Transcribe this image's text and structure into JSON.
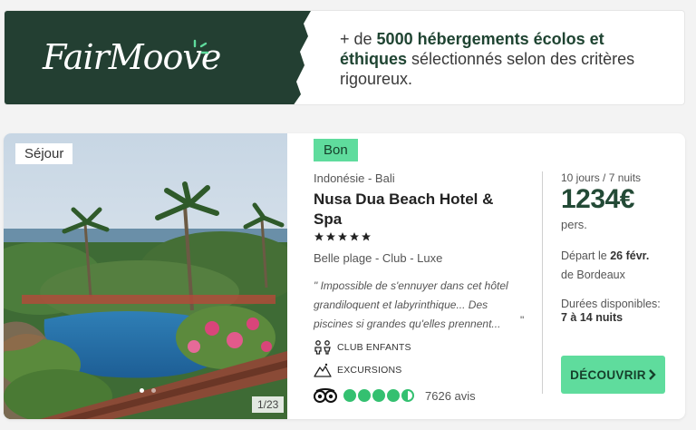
{
  "banner": {
    "logo_text": "FairMoove",
    "text_prefix": "+ de ",
    "text_bold": "5000 hébergements écolos et éthiques",
    "text_suffix": " sélectionnés selon des critères rigoureux."
  },
  "card": {
    "tag": "Séjour",
    "photo_counter": "1/23",
    "rating_label": "Bon",
    "location": "Indonésie - Bali",
    "name": "Nusa Dua Beach Hotel & Spa",
    "stars": 5,
    "features": "Belle plage - Club - Luxe",
    "quote": "\" Impossible de s'ennuyer dans cet hôtel grandiloquent et labyrinthique... Des piscines si grandes qu'elles prennent...",
    "quote_close": "\"",
    "amenities": [
      "CLUB ENFANTS",
      "EXCURSIONS"
    ],
    "review_count": "7626 avis",
    "duration": "10 jours / 7 nuits",
    "price": "1234€",
    "per": "pers.",
    "depart_prefix": "Départ le ",
    "depart_date": "26 févr.",
    "depart_city": "de Bordeaux",
    "durees_label": "Durées disponibles:",
    "durees_value": "7 à 14 nuits",
    "cta_label": "DÉCOUVRIR"
  },
  "colors": {
    "brand_dark": "#233f32",
    "accent_green": "#5fdc9d",
    "price_green": "#234a36",
    "tripadvisor_green": "#34c070"
  },
  "icons": [
    "spark-icon",
    "star-icon",
    "children-icon",
    "mountain-icon",
    "tripadvisor-icon",
    "chevron-right-icon"
  ]
}
